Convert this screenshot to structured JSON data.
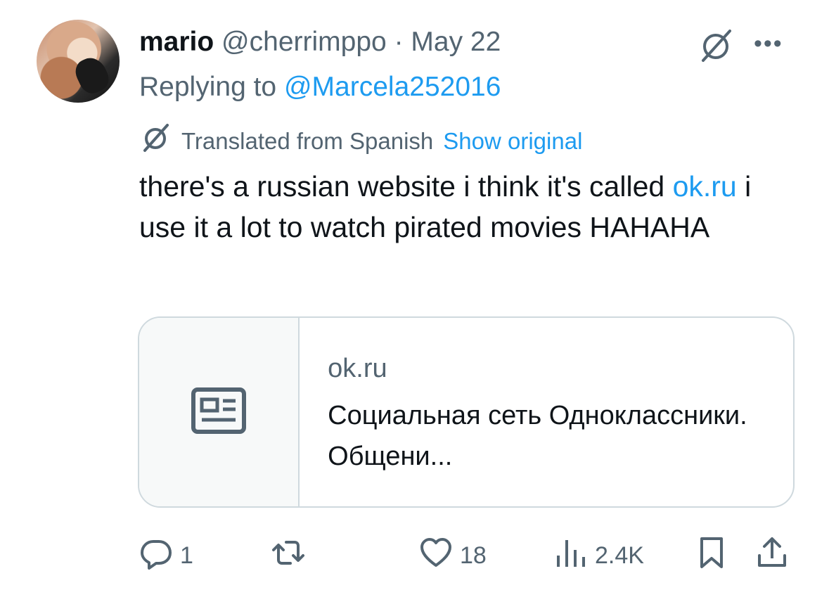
{
  "author": {
    "display_name": "mario",
    "handle": "@cherrimppo",
    "separator": "·",
    "date": "May 22"
  },
  "reply": {
    "prefix": "Replying to",
    "to": "@Marcela252016"
  },
  "translation": {
    "label": "Translated from Spanish",
    "show_original": "Show original"
  },
  "tweet": {
    "text_before": "there's a russian website i think it's called",
    "link": "ok.ru",
    "text_after": "i use it a lot to watch pirated movies HAHAHA"
  },
  "card": {
    "domain": "ok.ru",
    "title": "Социальная сеть Одноклассники. Общени..."
  },
  "actions": {
    "replies": "1",
    "likes": "18",
    "views": "2.4K"
  },
  "colors": {
    "link": "#1d9bf0",
    "muted": "#536471",
    "text": "#0f1419",
    "border": "#cfd9de"
  },
  "icons": [
    "grok-icon",
    "more-icon",
    "translate-icon",
    "article-icon",
    "reply-icon",
    "retweet-icon",
    "like-icon",
    "views-icon",
    "bookmark-icon",
    "share-icon"
  ]
}
